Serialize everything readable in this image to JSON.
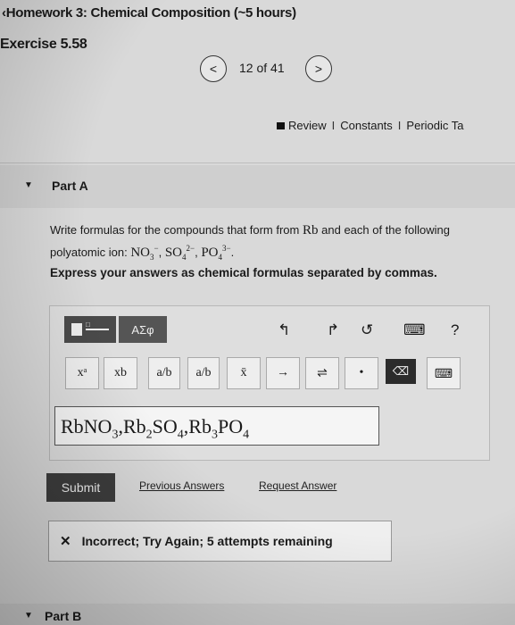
{
  "header": {
    "title": "Homework 3: Chemical Composition (~5 hours)",
    "back_icon": "chevron-left-icon",
    "exercise": "Exercise 5.58",
    "pager": {
      "prev_symbol": "<",
      "position": "12 of 41",
      "next_symbol": ">"
    }
  },
  "toplinks": {
    "review": "Review",
    "sep": "I",
    "constants": "Constants",
    "periodic": "Periodic Ta"
  },
  "part_a": {
    "label": "Part A",
    "caret": "▼",
    "question_line1": "Write formulas for the compounds that form from",
    "element": "Rb",
    "question_line1b": "and each of the following",
    "question_line2_prefix": "polyatomic ion:",
    "ions": {
      "nitrate": {
        "base": "NO",
        "sub": "3",
        "sup": "−"
      },
      "sulfate": {
        "base": "SO",
        "sub": "4",
        "sup": "2−"
      },
      "phosphate": {
        "base": "PO",
        "sub": "4",
        "sup": "3−"
      }
    },
    "instruction": "Express your answers as chemical formulas separated by commas."
  },
  "editor": {
    "templates_label": "□",
    "greek_label": "ΑΣφ",
    "undo": "↰",
    "redo": "↱",
    "reset": "↺",
    "keyboard_label": "⌨",
    "help": "?",
    "symbols": {
      "superscript": "xᵃ",
      "subscript": "xb",
      "fraction": "a/b",
      "mixed": "a/b",
      "overbar": "x̄",
      "arrow": "→",
      "equilibrium": "⇌",
      "dot": "•",
      "delete": "⌫",
      "keyboard": "⌨"
    },
    "answer": {
      "parts": [
        {
          "t": "RbNO"
        },
        {
          "s": "3"
        },
        {
          "t": ",Rb"
        },
        {
          "s": "2"
        },
        {
          "t": "SO"
        },
        {
          "s": "4"
        },
        {
          "t": ",Rb"
        },
        {
          "s": "3"
        },
        {
          "t": "PO"
        },
        {
          "s": "4"
        }
      ]
    }
  },
  "actions": {
    "submit": "Submit",
    "previous_answers": "Previous Answers",
    "request_answer": "Request Answer"
  },
  "feedback": {
    "text": "Incorrect; Try Again; 5 attempts remaining",
    "icon": "x-icon"
  },
  "part_b": {
    "label": "Part B",
    "caret": "▼"
  }
}
